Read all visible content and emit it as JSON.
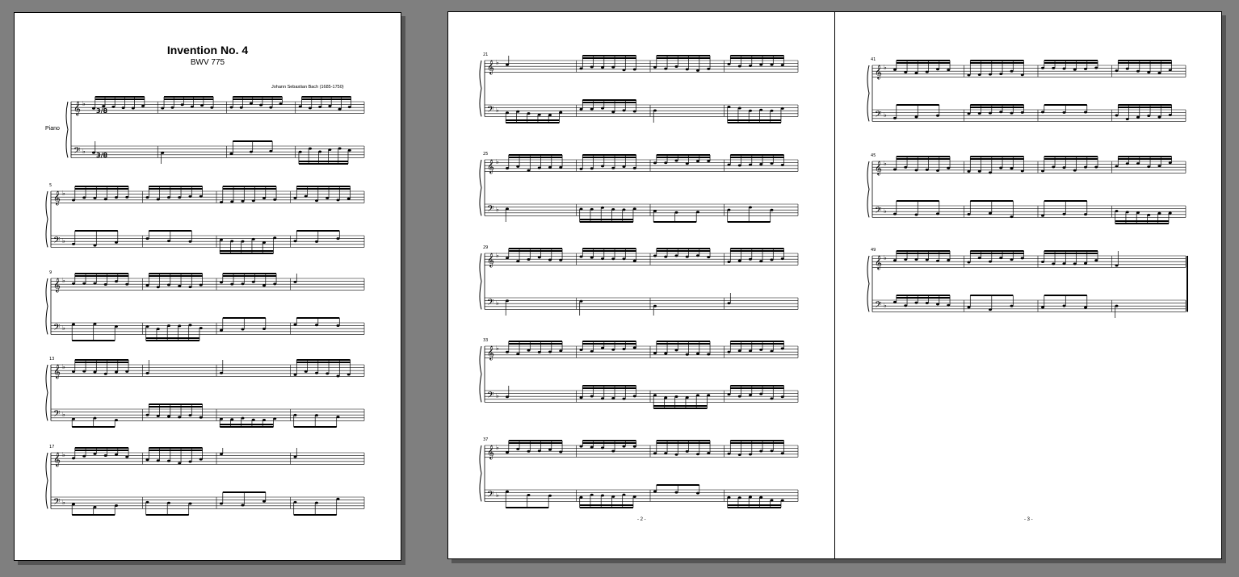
{
  "score": {
    "title": "Invention No. 4",
    "subtitle": "BWV 775",
    "composer": "Johann Sebastian Bach (1685-1750)",
    "instrument": "Piano",
    "page_numbers": [
      "- 2 -",
      "- 3 -"
    ],
    "measure_numbers": [
      "5",
      "9",
      "13",
      "17",
      "21",
      "25",
      "29",
      "33",
      "37",
      "41",
      "45",
      "49"
    ],
    "time_signature": "3/8",
    "key_signature": "D minor (one flat)"
  },
  "colors": {
    "background": "#7f7f7f",
    "page": "#ffffff",
    "ink": "#000000",
    "shadow": "#555555"
  }
}
